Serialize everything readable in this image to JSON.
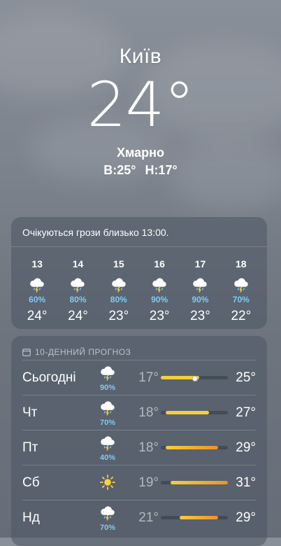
{
  "city": "Київ",
  "current_temp": "24°",
  "condition": "Хмарно",
  "high": "В:25°",
  "low": "Н:17°",
  "hourly": {
    "alert": "Очікуються грози близько 13:00.",
    "items": [
      {
        "hour": "13",
        "precip": "60%",
        "temp": "24°",
        "icon": "thunderstorm-cloud-icon"
      },
      {
        "hour": "14",
        "precip": "80%",
        "temp": "24°",
        "icon": "thunderstorm-cloud-icon"
      },
      {
        "hour": "15",
        "precip": "80%",
        "temp": "23°",
        "icon": "thunderstorm-cloud-icon"
      },
      {
        "hour": "16",
        "precip": "90%",
        "temp": "23°",
        "icon": "thunderstorm-cloud-icon"
      },
      {
        "hour": "17",
        "precip": "90%",
        "temp": "23°",
        "icon": "thunderstorm-cloud-icon"
      },
      {
        "hour": "18",
        "precip": "70%",
        "temp": "22°",
        "icon": "thunderstorm-cloud-icon"
      }
    ]
  },
  "daily": {
    "title": "10-ДЕННИЙ ПРОГНОЗ",
    "icon": "calendar-icon",
    "range_min": 17,
    "range_max": 31,
    "current_value": 24,
    "days": [
      {
        "day": "Сьогодні",
        "icon": "thunderstorm-cloud-icon",
        "precip": "90%",
        "low": "17°",
        "high": "25°",
        "low_value": 17,
        "high_value": 25
      },
      {
        "day": "Чт",
        "icon": "thunderstorm-cloud-icon",
        "precip": "70%",
        "low": "18°",
        "high": "27°",
        "low_value": 18,
        "high_value": 27
      },
      {
        "day": "Пт",
        "icon": "thunderstorm-cloud-icon",
        "precip": "40%",
        "low": "18°",
        "high": "29°",
        "low_value": 18,
        "high_value": 29
      },
      {
        "day": "Сб",
        "icon": "sun-icon",
        "precip": "",
        "low": "19°",
        "high": "31°",
        "low_value": 19,
        "high_value": 31
      },
      {
        "day": "Нд",
        "icon": "thunderstorm-cloud-icon",
        "precip": "70%",
        "low": "21°",
        "high": "29°",
        "low_value": 21,
        "high_value": 29
      }
    ]
  },
  "colors": {
    "precip_blue": "#7ecbf3",
    "bar_yellow": "#f4cf3a",
    "bar_orange": "#f0902a",
    "sun_yellow": "#f9d23c"
  }
}
